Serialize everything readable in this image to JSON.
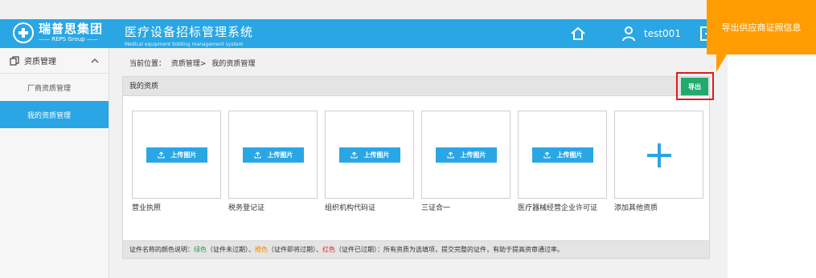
{
  "brand": {
    "name_cn": "瑞普思集团",
    "name_en": "—— REPS Group ——"
  },
  "system": {
    "title_cn": "医疗设备招标管理系统",
    "title_en": "Medical equipment bidding management system"
  },
  "header": {
    "user": "test001",
    "icons": [
      "home-icon",
      "user-icon",
      "exit-icon"
    ],
    "color": "#2aa6e4"
  },
  "callout": {
    "text": "导出供应商证照信息",
    "color": "#ff9c00"
  },
  "sidebar": {
    "group": {
      "label": "资质管理",
      "icon": "documents-icon",
      "expanded": true
    },
    "items": [
      {
        "label": "厂商资质管理",
        "active": false
      },
      {
        "label": "我的资质管理",
        "active": true
      }
    ]
  },
  "breadcrumb": {
    "prefix": "当前位置：",
    "path1": "资质管理>",
    "path2": "我的资质管理"
  },
  "panel": {
    "title": "我的资质",
    "export_label": "导出",
    "cards": [
      {
        "label": "营业执照",
        "button": "上传图片"
      },
      {
        "label": "税务登记证",
        "button": "上传图片"
      },
      {
        "label": "组织机构代码证",
        "button": "上传图片"
      },
      {
        "label": "三证合一",
        "button": "上传图片"
      },
      {
        "label": "医疗器械经营企业许可证",
        "button": "上传图片"
      }
    ],
    "add_card": {
      "label": "添加其他资质",
      "icon": "plus-icon"
    },
    "legend": {
      "prefix": "证件名称的颜色说明：",
      "green": "绿色",
      "green_desc": "（证件未过期）、",
      "orange": "橙色",
      "orange_desc": "（证件即将过期）、",
      "red": "红色",
      "red_desc": "（证件已过期）：所有资质为选填项，提交完整的证件，有助于提高资审通过率。"
    }
  },
  "colors": {
    "green": "#21a34a",
    "orange": "#f08c00",
    "red": "#e02424",
    "export": "#22aa6e"
  }
}
